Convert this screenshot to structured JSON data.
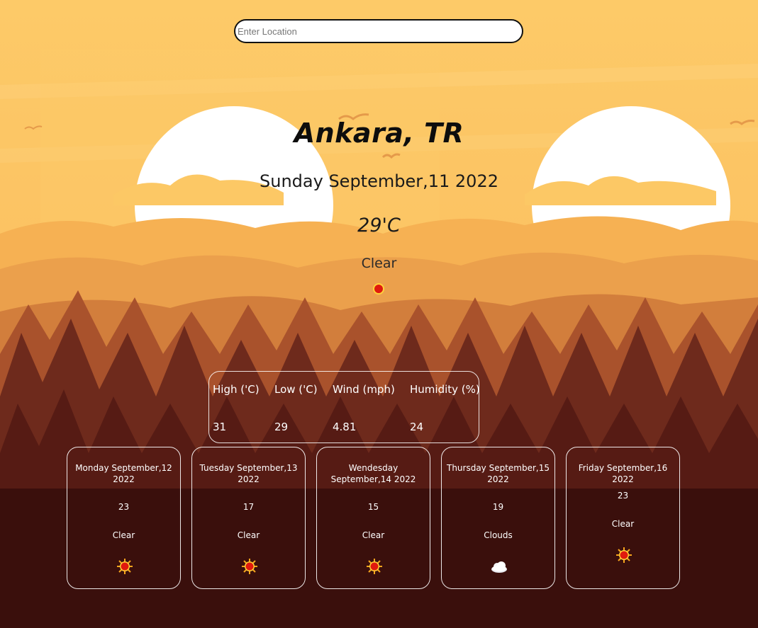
{
  "search": {
    "placeholder": "Enter Location"
  },
  "current": {
    "city": "Ankara, TR",
    "date": "Sunday September,11 2022",
    "temperature": "29'C",
    "condition": "Clear",
    "icon": "sun-icon"
  },
  "stats": {
    "headers": [
      "High ('C)",
      "Low ('C)",
      "Wind (mph)",
      "Humidity (%)"
    ],
    "values": [
      "31",
      "29",
      "4.81",
      "24"
    ]
  },
  "forecast": [
    {
      "date": "Monday September,12 2022",
      "temp": "23",
      "condition": "Clear",
      "icon": "sun-icon"
    },
    {
      "date": "Tuesday September,13 2022",
      "temp": "17",
      "condition": "Clear",
      "icon": "sun-icon"
    },
    {
      "date": "Wendesday September,14 2022",
      "temp": "15",
      "condition": "Clear",
      "icon": "sun-icon"
    },
    {
      "date": "Thursday September,15 2022",
      "temp": "19",
      "condition": "Clouds",
      "icon": "cloud-icon"
    },
    {
      "date": "Friday September,16 2022",
      "temp": "23",
      "condition": "Clear",
      "icon": "sun-icon"
    }
  ],
  "colors": {
    "sky": "#fcc865",
    "sun": "#ffffff",
    "forest_dark": "#3a0f0c",
    "text_dark": "#0d0d0d",
    "text_light": "#ffffff"
  }
}
